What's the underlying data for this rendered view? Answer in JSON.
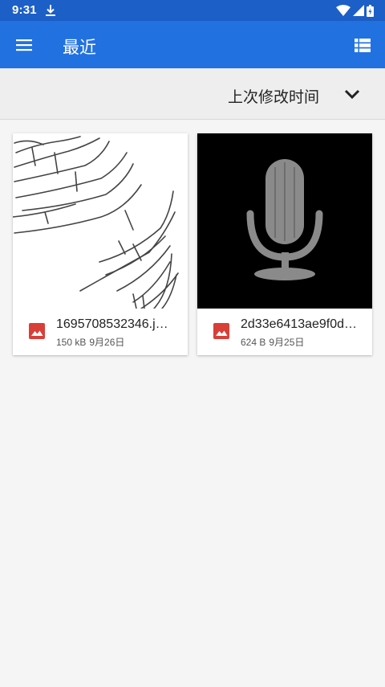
{
  "status_bar": {
    "time": "9:31",
    "icons": [
      "download-icon",
      "wifi-icon",
      "signal-icon",
      "battery-icon"
    ]
  },
  "app_bar": {
    "title": "最近",
    "menu_icon": "menu-icon",
    "view_toggle_icon": "list-view-icon",
    "color": "#2271e0",
    "status_color": "#1c5fc7"
  },
  "sort_bar": {
    "label": "上次修改时间",
    "toggle_icon": "chevron-down-icon"
  },
  "files": [
    {
      "name": "1695708532346.j…",
      "size": "150 kB",
      "date": "9月26日",
      "type_icon": "image-file-icon",
      "thumbnail": "handwritten-scribble"
    },
    {
      "name": "2d33e6413ae9f0d…",
      "size": "624 B",
      "date": "9月25日",
      "type_icon": "image-file-icon",
      "thumbnail": "microphone-on-black"
    }
  ],
  "colors": {
    "file_icon": "#d93f37",
    "background": "#f5f5f5"
  }
}
